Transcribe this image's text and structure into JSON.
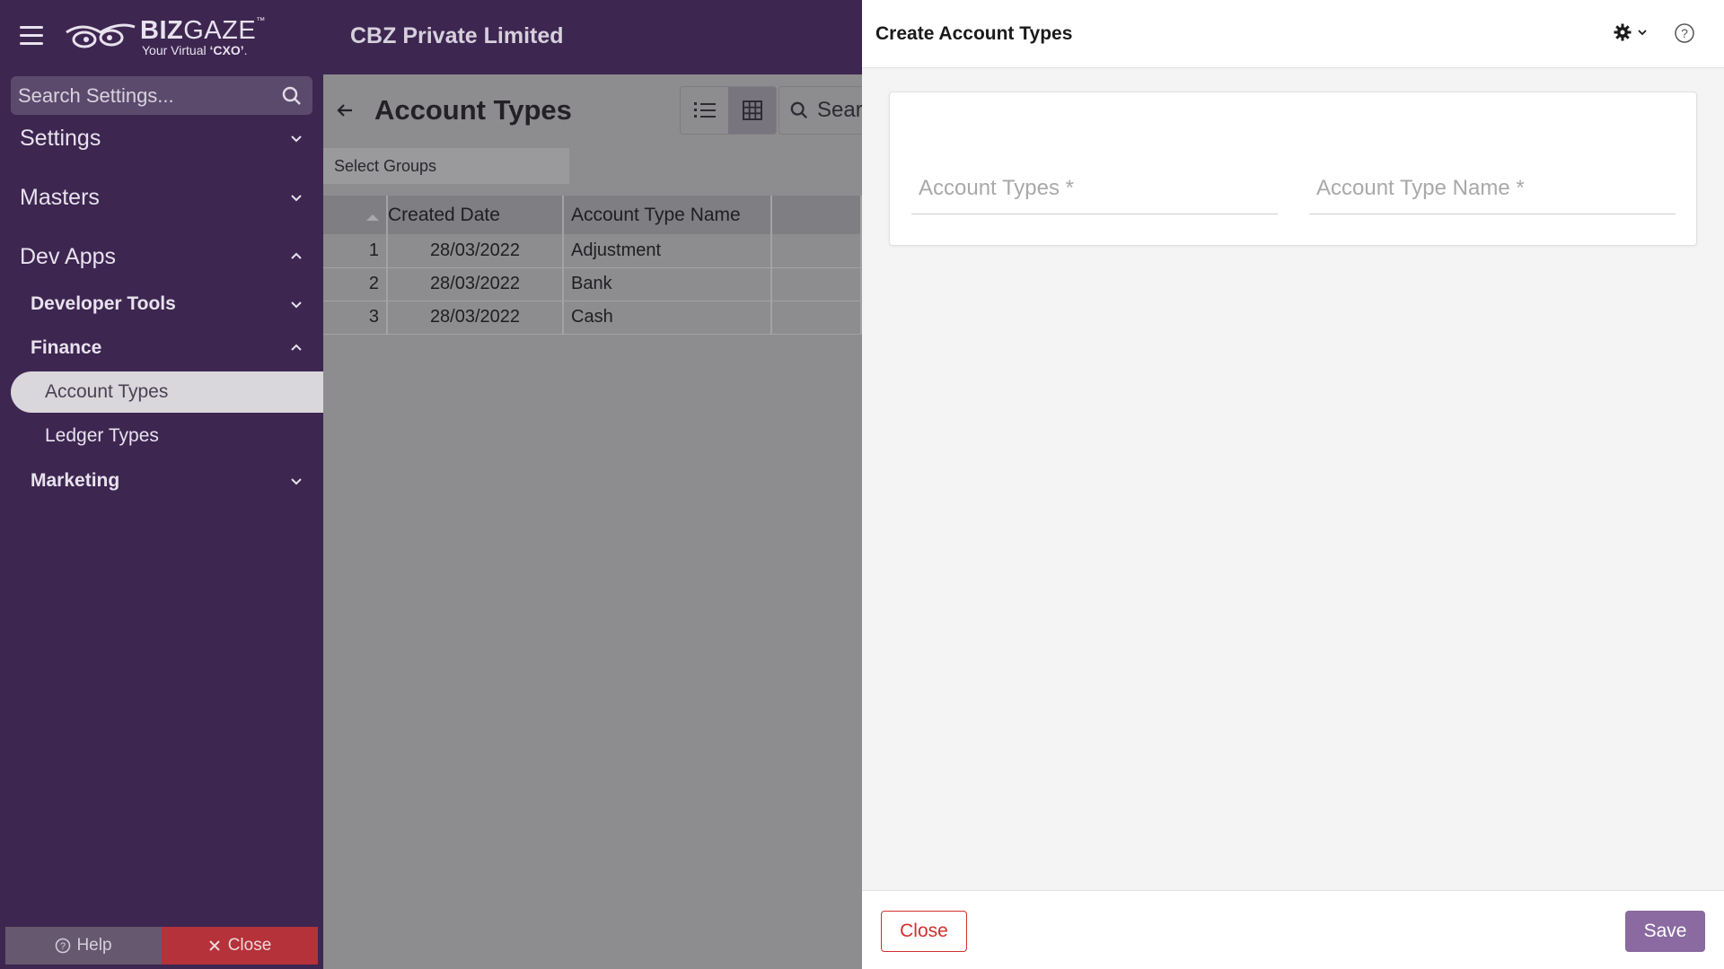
{
  "header": {
    "logo_brand_bold": "BIZ",
    "logo_brand_light": "GAZE",
    "logo_tm": "™",
    "logo_tagline_prefix": "Your Virtual ",
    "logo_tagline_bold": "‘CXO’",
    "logo_tagline_suffix": ".",
    "company_name": "CBZ Private Limited"
  },
  "sidebar": {
    "search_placeholder": "Search Settings...",
    "items": [
      {
        "label": "Settings",
        "level": 1,
        "expanded": false
      },
      {
        "label": "Masters",
        "level": 1,
        "expanded": false
      },
      {
        "label": "Dev Apps",
        "level": 1,
        "expanded": true
      },
      {
        "label": "Developer Tools",
        "level": 2,
        "expanded": false
      },
      {
        "label": "Finance",
        "level": 2,
        "expanded": true
      },
      {
        "label": "Account Types",
        "level": 3,
        "active": true
      },
      {
        "label": "Ledger Types",
        "level": 3,
        "active": false
      },
      {
        "label": "Marketing",
        "level": 2,
        "expanded": false
      }
    ],
    "footer": {
      "help_label": "Help",
      "close_label": "Close"
    }
  },
  "main": {
    "title": "Account Types",
    "search_text": "Sear",
    "select_groups_label": "Select Groups",
    "columns": [
      "Created Date",
      "Account Type Name"
    ],
    "rows": [
      {
        "index": "1",
        "created_date": "28/03/2022",
        "name": "Adjustment"
      },
      {
        "index": "2",
        "created_date": "28/03/2022",
        "name": "Bank"
      },
      {
        "index": "3",
        "created_date": "28/03/2022",
        "name": "Cash"
      }
    ]
  },
  "drawer": {
    "title": "Create Account Types",
    "fields": [
      {
        "placeholder": "Account Types *",
        "value": ""
      },
      {
        "placeholder": "Account Type Name *",
        "value": ""
      }
    ],
    "close_label": "Close",
    "save_label": "Save"
  },
  "colors": {
    "sidebar_bg": "#3d2650",
    "accent_purple": "#8a6aa0",
    "close_red": "#d32f2f",
    "overlay_gray": "#8d8c8e"
  }
}
